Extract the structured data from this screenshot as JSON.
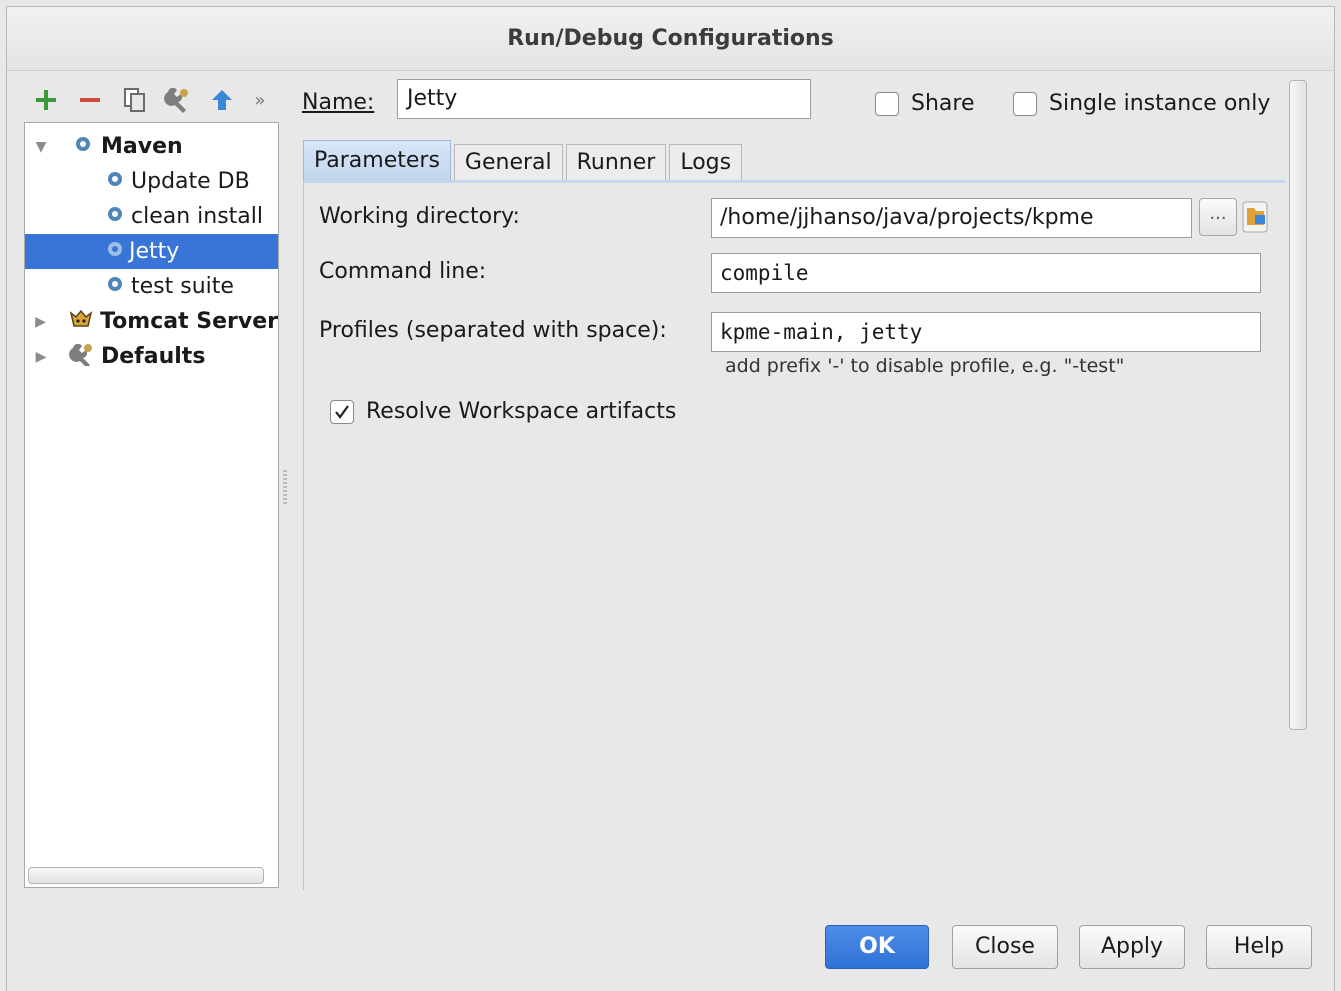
{
  "dialog": {
    "title": "Run/Debug Configurations"
  },
  "toolbar": {
    "icons": [
      "add-icon",
      "remove-icon",
      "copy-icon",
      "edit-defaults-icon",
      "move-up-icon",
      "more-icon"
    ],
    "more_label": "»"
  },
  "tree": {
    "items": [
      {
        "label": "Maven",
        "icon": "gear-icon",
        "expanded": true
      },
      {
        "label": "Update DB",
        "icon": "gear-icon"
      },
      {
        "label": "clean install",
        "icon": "gear-icon"
      },
      {
        "label": "Jetty",
        "icon": "gear-icon",
        "selected": true
      },
      {
        "label": "test suite",
        "icon": "gear-icon"
      },
      {
        "label": "Tomcat Server",
        "icon": "tomcat-icon",
        "expanded": false
      },
      {
        "label": "Defaults",
        "icon": "wrench-icon",
        "expanded": false
      }
    ]
  },
  "name": {
    "label": "Name:",
    "value": "Jetty"
  },
  "share": {
    "label": "Share",
    "checked": false
  },
  "single_instance": {
    "label": "Single instance only",
    "checked": false
  },
  "tabs": [
    "Parameters",
    "General",
    "Runner",
    "Logs"
  ],
  "active_tab": "Parameters",
  "parameters": {
    "working_directory": {
      "label": "Working directory:",
      "value": "/home/jjhanso/java/projects/kpme",
      "browse": "..."
    },
    "command_line": {
      "label": "Command line:",
      "value": "compile"
    },
    "profiles": {
      "label": "Profiles (separated with space):",
      "value": "kpme-main, jetty",
      "hint": "add prefix '-' to disable profile, e.g. \"-test\""
    },
    "resolve_workspace": {
      "label": "Resolve Workspace artifacts",
      "checked": true
    }
  },
  "buttons": {
    "ok": "OK",
    "close": "Close",
    "apply": "Apply",
    "help": "Help"
  },
  "colors": {
    "accent": "#3875d7",
    "primary_button": "#2f72d6"
  }
}
